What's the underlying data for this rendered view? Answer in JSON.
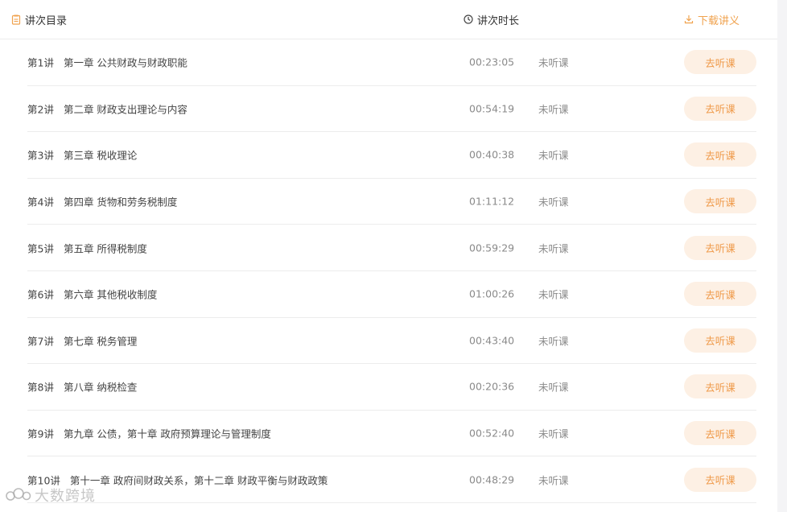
{
  "header": {
    "catalog_label": "讲次目录",
    "duration_label": "讲次时长",
    "download_label": "下载讲义"
  },
  "action_label": "去听课",
  "lectures": [
    {
      "no": "第1讲",
      "title": "第一章 公共财政与财政职能",
      "duration": "00:23:05",
      "status": "未听课"
    },
    {
      "no": "第2讲",
      "title": "第二章 财政支出理论与内容",
      "duration": "00:54:19",
      "status": "未听课"
    },
    {
      "no": "第3讲",
      "title": "第三章 税收理论",
      "duration": "00:40:38",
      "status": "未听课"
    },
    {
      "no": "第4讲",
      "title": "第四章 货物和劳务税制度",
      "duration": "01:11:12",
      "status": "未听课"
    },
    {
      "no": "第5讲",
      "title": "第五章 所得税制度",
      "duration": "00:59:29",
      "status": "未听课"
    },
    {
      "no": "第6讲",
      "title": "第六章 其他税收制度",
      "duration": "01:00:26",
      "status": "未听课"
    },
    {
      "no": "第7讲",
      "title": "第七章 税务管理",
      "duration": "00:43:40",
      "status": "未听课"
    },
    {
      "no": "第8讲",
      "title": "第八章 纳税检查",
      "duration": "00:20:36",
      "status": "未听课"
    },
    {
      "no": "第9讲",
      "title": "第九章 公债，第十章 政府预算理论与管理制度",
      "duration": "00:52:40",
      "status": "未听课"
    },
    {
      "no": "第10讲",
      "title": "第十一章 政府间财政关系，第十二章 财政平衡与财政政策",
      "duration": "00:48:29",
      "status": "未听课"
    }
  ],
  "watermark": "大数跨境",
  "colors": {
    "accent": "#f0a24e",
    "button_bg": "#fdf0e4",
    "muted_text": "#8a8a8a",
    "divider": "#ececec"
  },
  "icons": {
    "catalog": "document-list-icon",
    "duration": "clock-icon",
    "download": "download-icon"
  }
}
